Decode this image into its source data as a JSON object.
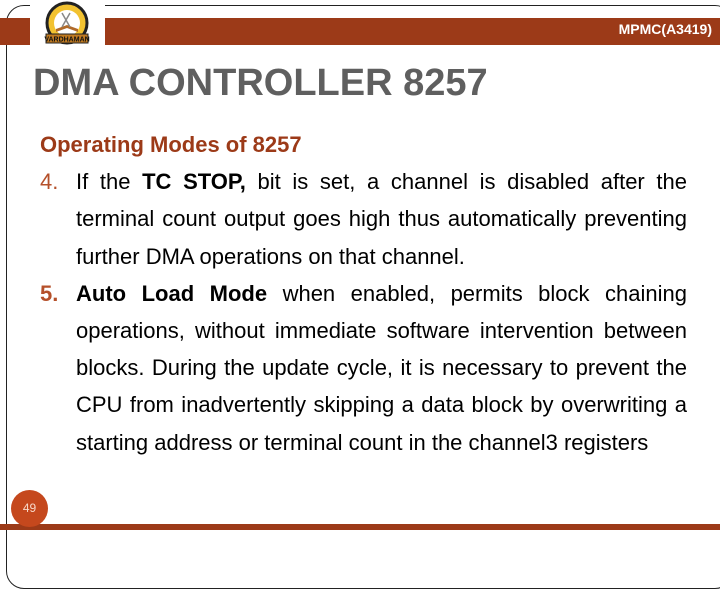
{
  "header": {
    "course_code": "MPMC(A3419)",
    "logo": {
      "name": "vardhaman-college-logo",
      "text": "VARDHAMAN"
    }
  },
  "slide": {
    "title": "DMA CONTROLLER 8257",
    "subtitle": "Operating Modes of 8257",
    "items": [
      {
        "number": "4.",
        "text_before": "If the ",
        "bold": "TC STOP,",
        "text_after": " bit is set, a channel is disabled after the terminal count output goes high thus automatically preventing further DMA operations on that channel."
      },
      {
        "number": "5.",
        "text_before": "",
        "bold": "Auto Load Mode",
        "text_after": " when enabled, permits block chaining operations, without immediate software intervention between blocks. During the update cycle, it is necessary to prevent the CPU from inadvertently skipping a data block by overwriting a starting address or terminal count in the channel3 registers"
      }
    ]
  },
  "footer": {
    "page_number": "49"
  },
  "colors": {
    "accent": "#9c3a18",
    "title": "#5f5f5f",
    "page_badge": "#c5481d"
  }
}
